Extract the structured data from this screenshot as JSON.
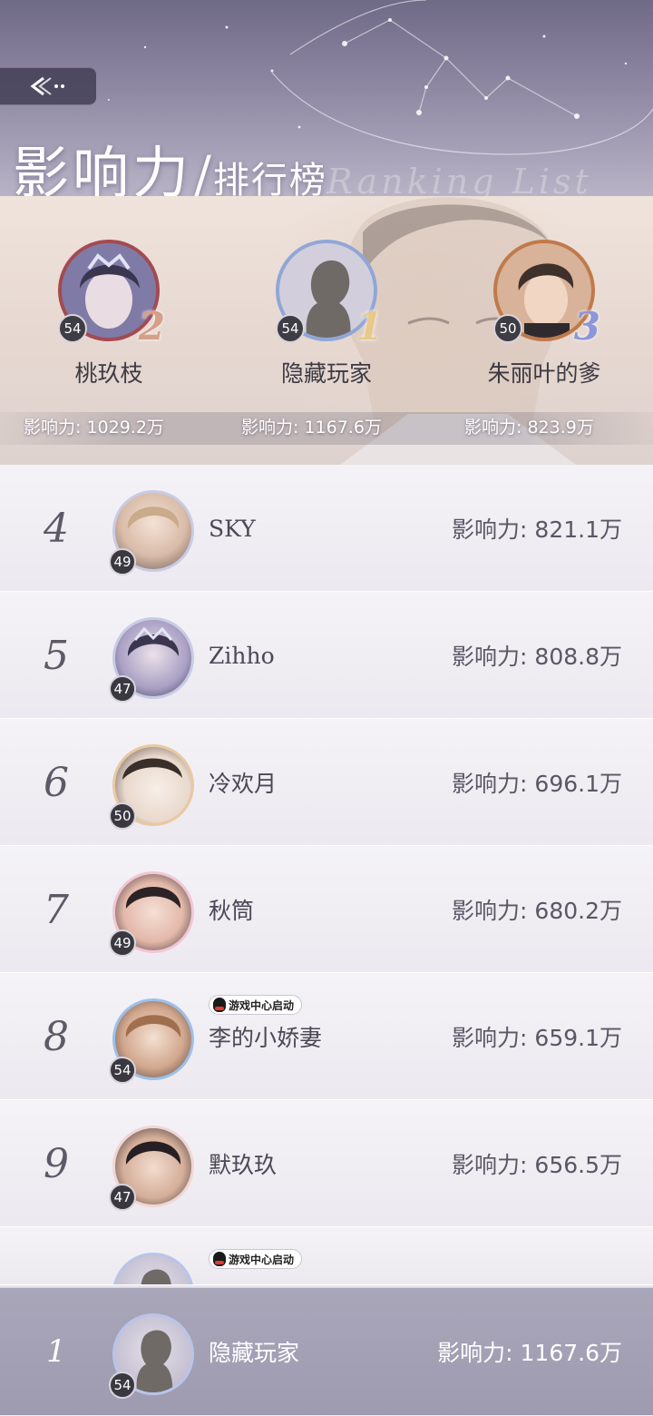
{
  "header": {
    "title_main": "影响力",
    "title_slash": "/",
    "title_sub": "排行榜",
    "title_en": "Ranking List"
  },
  "podium": [
    {
      "position": "second",
      "rank": "2",
      "name": "桃玖枝",
      "level": "54",
      "influence": "影响力: 1029.2万"
    },
    {
      "position": "first",
      "rank": "1",
      "name": "隐藏玩家",
      "level": "54",
      "influence": "影响力: 1167.6万"
    },
    {
      "position": "third",
      "rank": "3",
      "name": "朱丽叶的爹",
      "level": "50",
      "influence": "影响力: 823.9万"
    }
  ],
  "ranking": [
    {
      "rank": "4",
      "name": "SKY",
      "level": "49",
      "influence": "影响力: 821.1万",
      "badge": null
    },
    {
      "rank": "5",
      "name": "Zihho",
      "level": "47",
      "influence": "影响力: 808.8万",
      "badge": null
    },
    {
      "rank": "6",
      "name": "冷欢月",
      "level": "50",
      "influence": "影响力: 696.1万",
      "badge": null
    },
    {
      "rank": "7",
      "name": "秋筒",
      "level": "49",
      "influence": "影响力: 680.2万",
      "badge": null
    },
    {
      "rank": "8",
      "name": "李的小娇妻",
      "level": "54",
      "influence": "影响力: 659.1万",
      "badge": "游戏中心启动"
    },
    {
      "rank": "9",
      "name": "默玖玖",
      "level": "47",
      "influence": "影响力: 656.5万",
      "badge": null
    }
  ],
  "partial_row": {
    "badge": "游戏中心启动"
  },
  "self_row": {
    "rank": "1",
    "name": "隐藏玩家",
    "level": "54",
    "influence": "影响力: 1167.6万"
  },
  "icons": {
    "back": "back-arrow-icon",
    "qq": "qq-penguin-icon"
  },
  "colors": {
    "accent": "#8fa7d8",
    "header": "#8e88a3",
    "self_row": "#a9a6ba"
  }
}
